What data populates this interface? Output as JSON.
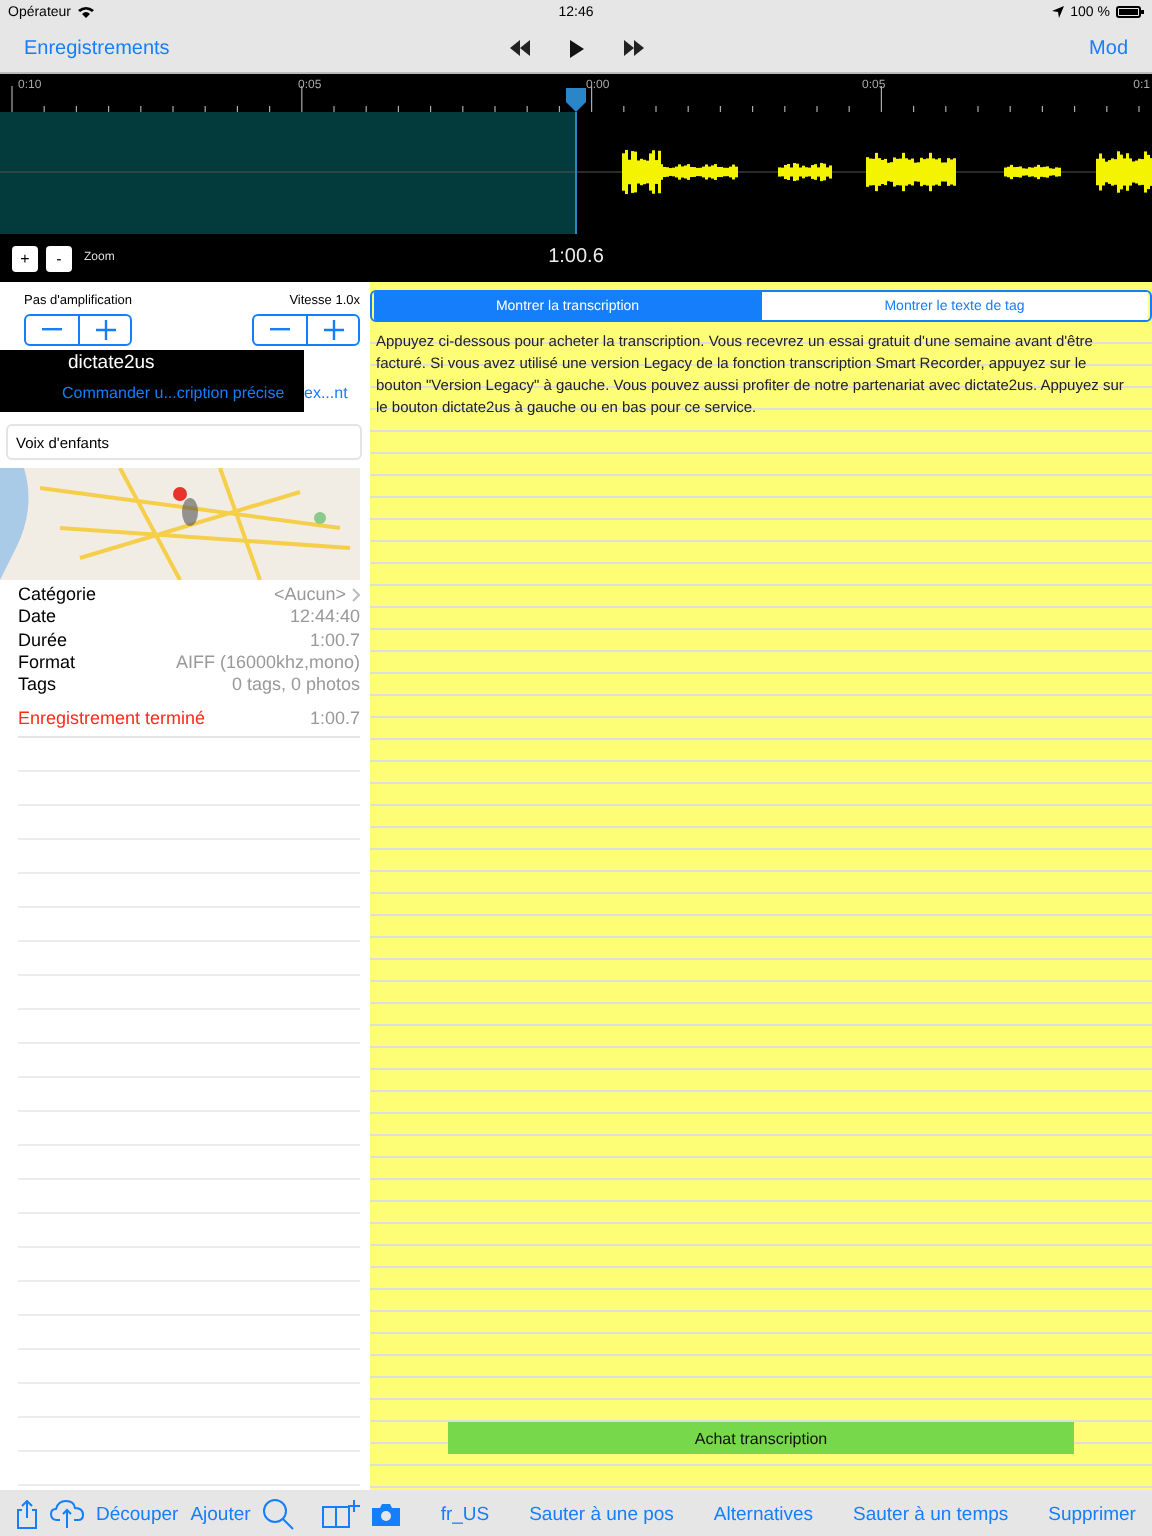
{
  "status_bar": {
    "carrier": "Opérateur",
    "time": "12:46",
    "battery": "100 %"
  },
  "nav_bar": {
    "back": "Enregistrements",
    "action": "Mod"
  },
  "timeline": {
    "ticks": [
      "0:10",
      "0:05",
      "0:00",
      "0:05",
      "0:1"
    ],
    "zoom_buttons": [
      "+",
      "-"
    ],
    "zoom_label": "Zoom",
    "position": "1:00.6"
  },
  "gain": {
    "label": "Pas d'amplification"
  },
  "speed": {
    "label": "Vitesse 1.0x"
  },
  "dictate": {
    "title": "dictate2us",
    "link": "Commander u...cription précise",
    "link_overflow": "ex...nt"
  },
  "voice_field": {
    "value": "Voix d'enfants"
  },
  "details": [
    {
      "label": "Catégorie",
      "value": "<Aucun>",
      "kind": "disclosure"
    },
    {
      "label": "Date",
      "value": "12:44:40",
      "kind": "plain"
    },
    {
      "label": "Durée",
      "value": "1:00.7",
      "kind": "plain"
    },
    {
      "label": "Format",
      "value": "AIFF (16000khz,mono)",
      "kind": "plain"
    },
    {
      "label": "Tags",
      "value": "0 tags, 0 photos",
      "kind": "plain"
    }
  ],
  "status_row": {
    "label": "Enregistrement terminé",
    "value": "1:00.7"
  },
  "tabs": [
    {
      "label": "Montrer la transcription",
      "selected": true
    },
    {
      "label": "Montrer le texte de tag",
      "selected": false
    }
  ],
  "transcript": {
    "text": "Appuyez ci-dessous pour acheter la transcription. Vous recevrez un essai gratuit d'une semaine avant d'être facturé. Si vous avez utilisé une version Legacy de la fonction transcription Smart Recorder, appuyez sur le bouton \"Version Legacy\" à gauche. Vous pouvez aussi profiter de notre partenariat avec dictate2us. Appuyez sur le bouton dictate2us à gauche ou en bas pour ce service.",
    "button": "Achat transcription"
  },
  "toolbar": {
    "left_actions": [
      "Découper",
      "Ajouter"
    ],
    "right_actions": [
      "fr_US",
      "Sauter à une pos",
      "Alternatives",
      "Sauter à un temps",
      "Supprimer"
    ]
  }
}
